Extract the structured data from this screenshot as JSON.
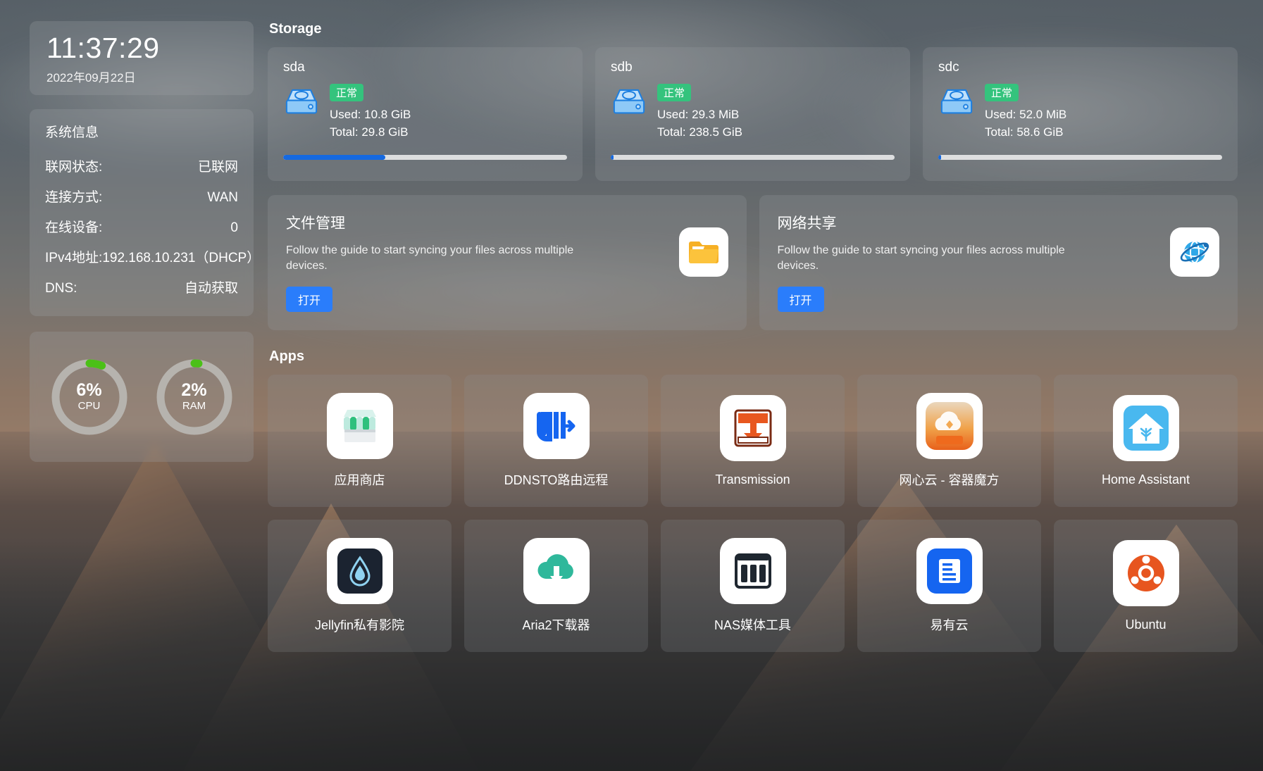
{
  "clock": {
    "time": "11:37:29",
    "date": "2022年09月22日"
  },
  "system_info": {
    "title": "系统信息",
    "rows": [
      {
        "label": "联网状态:",
        "value": "已联网"
      },
      {
        "label": "连接方式:",
        "value": "WAN"
      },
      {
        "label": "在线设备:",
        "value": "0"
      },
      {
        "label": "IPv4地址:",
        "value": "192.168.10.231（DHCP）"
      },
      {
        "label": "DNS:",
        "value": "自动获取"
      }
    ]
  },
  "gauges": [
    {
      "name": "CPU",
      "percent_label": "6%",
      "percent": 6,
      "color": "#4bc017",
      "track": "#b6b3ae"
    },
    {
      "name": "RAM",
      "percent_label": "2%",
      "percent": 2,
      "color": "#4bc017",
      "track": "#b6b3ae"
    }
  ],
  "storage": {
    "title": "Storage",
    "disks": [
      {
        "name": "sda",
        "status": "正常",
        "used": "Used: 10.8 GiB",
        "total": "Total: 29.8 GiB",
        "percent": 36,
        "icon": "hard-disk-icon"
      },
      {
        "name": "sdb",
        "status": "正常",
        "used": "Used: 29.3 MiB",
        "total": "Total: 238.5 GiB",
        "percent": 1,
        "icon": "hard-disk-icon"
      },
      {
        "name": "sdc",
        "status": "正常",
        "used": "Used: 52.0 MiB",
        "total": "Total: 58.6 GiB",
        "percent": 1,
        "icon": "hard-disk-icon"
      }
    ],
    "bar_color": "#1569e0",
    "badge_color": "#34c37d"
  },
  "guides": [
    {
      "title": "文件管理",
      "desc": "Follow the guide to start syncing your files across multiple devices.",
      "button": "打开",
      "icon": "folder-icon"
    },
    {
      "title": "网络共享",
      "desc": "Follow the guide to start syncing your files across multiple devices.",
      "button": "打开",
      "icon": "globe-network-icon"
    }
  ],
  "apps": {
    "title": "Apps",
    "items": [
      {
        "label": "应用商店",
        "icon": "app-store-icon"
      },
      {
        "label": "DDNSTO路由远程",
        "icon": "ddnsto-icon"
      },
      {
        "label": "Transmission",
        "icon": "transmission-icon"
      },
      {
        "label": "网心云 - 容器魔方",
        "icon": "wangxinyun-icon"
      },
      {
        "label": "Home Assistant",
        "icon": "home-assistant-icon"
      },
      {
        "label": "Jellyfin私有影院",
        "icon": "jellyfin-icon"
      },
      {
        "label": "Aria2下载器",
        "icon": "aria2-icon"
      },
      {
        "label": "NAS媒体工具",
        "icon": "nas-media-icon"
      },
      {
        "label": "易有云",
        "icon": "yiyouyun-icon"
      },
      {
        "label": "Ubuntu",
        "icon": "ubuntu-icon"
      }
    ]
  },
  "colors": {
    "accent_blue": "#2a7dfb",
    "progress_blue": "#1569e0",
    "status_green": "#34c37d",
    "gauge_green": "#4bc017"
  }
}
